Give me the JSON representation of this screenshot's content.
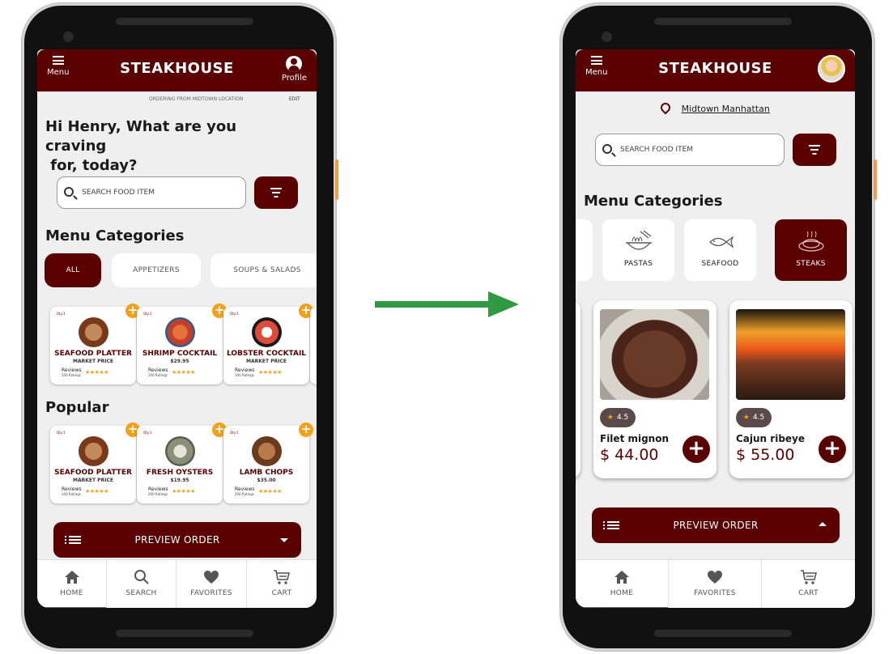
{
  "left_phone": {
    "app_title": "STEAKHOUSE",
    "menu_label": "Menu",
    "profile_label": "Profile",
    "ordering_text": "ORDERING FROM MIDTOWN LOCATION",
    "edit_label": "EDIT",
    "greeting_line1": "Hi Henry, What are you craving",
    "greeting_line2": " for, today?",
    "search_placeholder": "SEARCH FOOD ITEM",
    "menu_categories_heading": "Menu Categories",
    "category_pills": [
      "ALL",
      "APPETIZERS",
      "SOUPS & SALADS"
    ],
    "category_cards": [
      {
        "qty": "Qty:1",
        "name": "SEAFOOD PLATTER",
        "price": "MARKET PRICE",
        "reviews": "Reviews",
        "ratings": "100 Ratings",
        "stars": "★★★★★"
      },
      {
        "qty": "Qty:1",
        "name": "SHRIMP COCKTAIL",
        "price": "$29.95",
        "reviews": "Reviews",
        "ratings": "200 Ratings",
        "stars": "★★★★★"
      },
      {
        "qty": "Qty:1",
        "name": "LOBSTER COCKTAIL",
        "price": "MARKET PRICE",
        "reviews": "Reviews",
        "ratings": "100 Ratings",
        "stars": "★★★★★"
      }
    ],
    "popular_heading": "Popular",
    "popular_cards": [
      {
        "qty": "Qty:1",
        "name": "SEAFOOD PLATTER",
        "price": "MARKET PRICE",
        "reviews": "Reviews",
        "ratings": "100 Ratings",
        "stars": "★★★★★"
      },
      {
        "qty": "Qty:1",
        "name": "FRESH OYSTERS",
        "price": "$19.95",
        "reviews": "Reviews",
        "ratings": "200 Ratings",
        "stars": "★★★★★"
      },
      {
        "qty": "Qty:1",
        "name": "LAMB CHOPS",
        "price": "$35.00",
        "reviews": "Reviews",
        "ratings": "200 Ratings",
        "stars": "★★★★★"
      }
    ],
    "plus_symbol": "+",
    "preview_order_label": "PREVIEW ORDER",
    "nav": [
      "HOME",
      "SEARCH",
      "FAVORITES",
      "CART"
    ]
  },
  "right_phone": {
    "app_title": "STEAKHOUSE",
    "menu_label": "Menu",
    "location": "Midtown Manhattan",
    "search_placeholder": "SEARCH FOOD ITEM",
    "menu_categories_heading": "Menu Categories",
    "category_tiles": [
      "PASTAS",
      "SEAFOOD",
      "STEAKS"
    ],
    "products": [
      {
        "rating": "4.5",
        "name": "Filet mignon",
        "price": "$ 44.00"
      },
      {
        "rating": "4.5",
        "name": "Cajun ribeye",
        "price": "$ 55.00"
      }
    ],
    "star_symbol": "★",
    "plus_symbol": "+",
    "preview_order_label": "PREVIEW ORDER",
    "nav": [
      "HOME",
      "FAVORITES",
      "CART"
    ]
  },
  "colors": {
    "brand": "#5a0000",
    "accent": "#f5a01a",
    "arrow": "#2e9b43"
  }
}
